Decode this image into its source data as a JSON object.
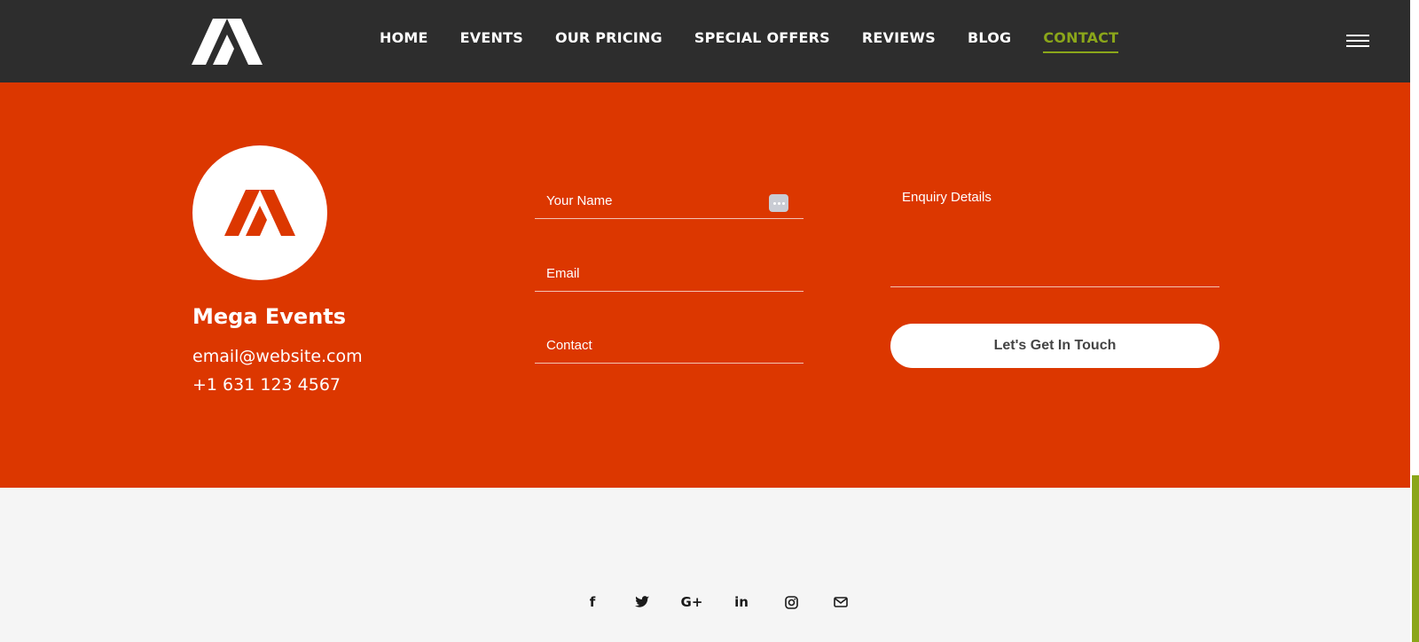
{
  "header": {
    "logo_icon": "mega-events-logo-icon",
    "nav": [
      {
        "label": "HOME",
        "active": false
      },
      {
        "label": "EVENTS",
        "active": false
      },
      {
        "label": "OUR PRICING",
        "active": false
      },
      {
        "label": "SPECIAL OFFERS",
        "active": false
      },
      {
        "label": "REVIEWS",
        "active": false
      },
      {
        "label": "BLOG",
        "active": false
      },
      {
        "label": "CONTACT",
        "active": true
      }
    ],
    "menu_icon": "hamburger-menu-icon"
  },
  "contact": {
    "brand_name": "Mega Events",
    "email": "email@website.com",
    "phone": "+1 631 123 4567",
    "form": {
      "name_placeholder": "Your Name",
      "email_placeholder": "Email",
      "contact_placeholder": "Contact",
      "enquiry_placeholder": "Enquiry Details",
      "submit_label": "Let's Get In Touch"
    }
  },
  "footer": {
    "social": [
      {
        "icon": "facebook-icon",
        "glyph": "f"
      },
      {
        "icon": "twitter-icon",
        "glyph": "🐦"
      },
      {
        "icon": "google-plus-icon",
        "glyph": "G+"
      },
      {
        "icon": "linkedin-icon",
        "glyph": "in"
      },
      {
        "icon": "instagram-icon",
        "glyph": "◎"
      },
      {
        "icon": "envelope-icon",
        "glyph": "✉"
      }
    ]
  },
  "colors": {
    "header_bg": "#2d2d2d",
    "accent": "#8ba61a",
    "contact_bg": "#dc3700",
    "footer_bg": "#f5f5f5"
  }
}
